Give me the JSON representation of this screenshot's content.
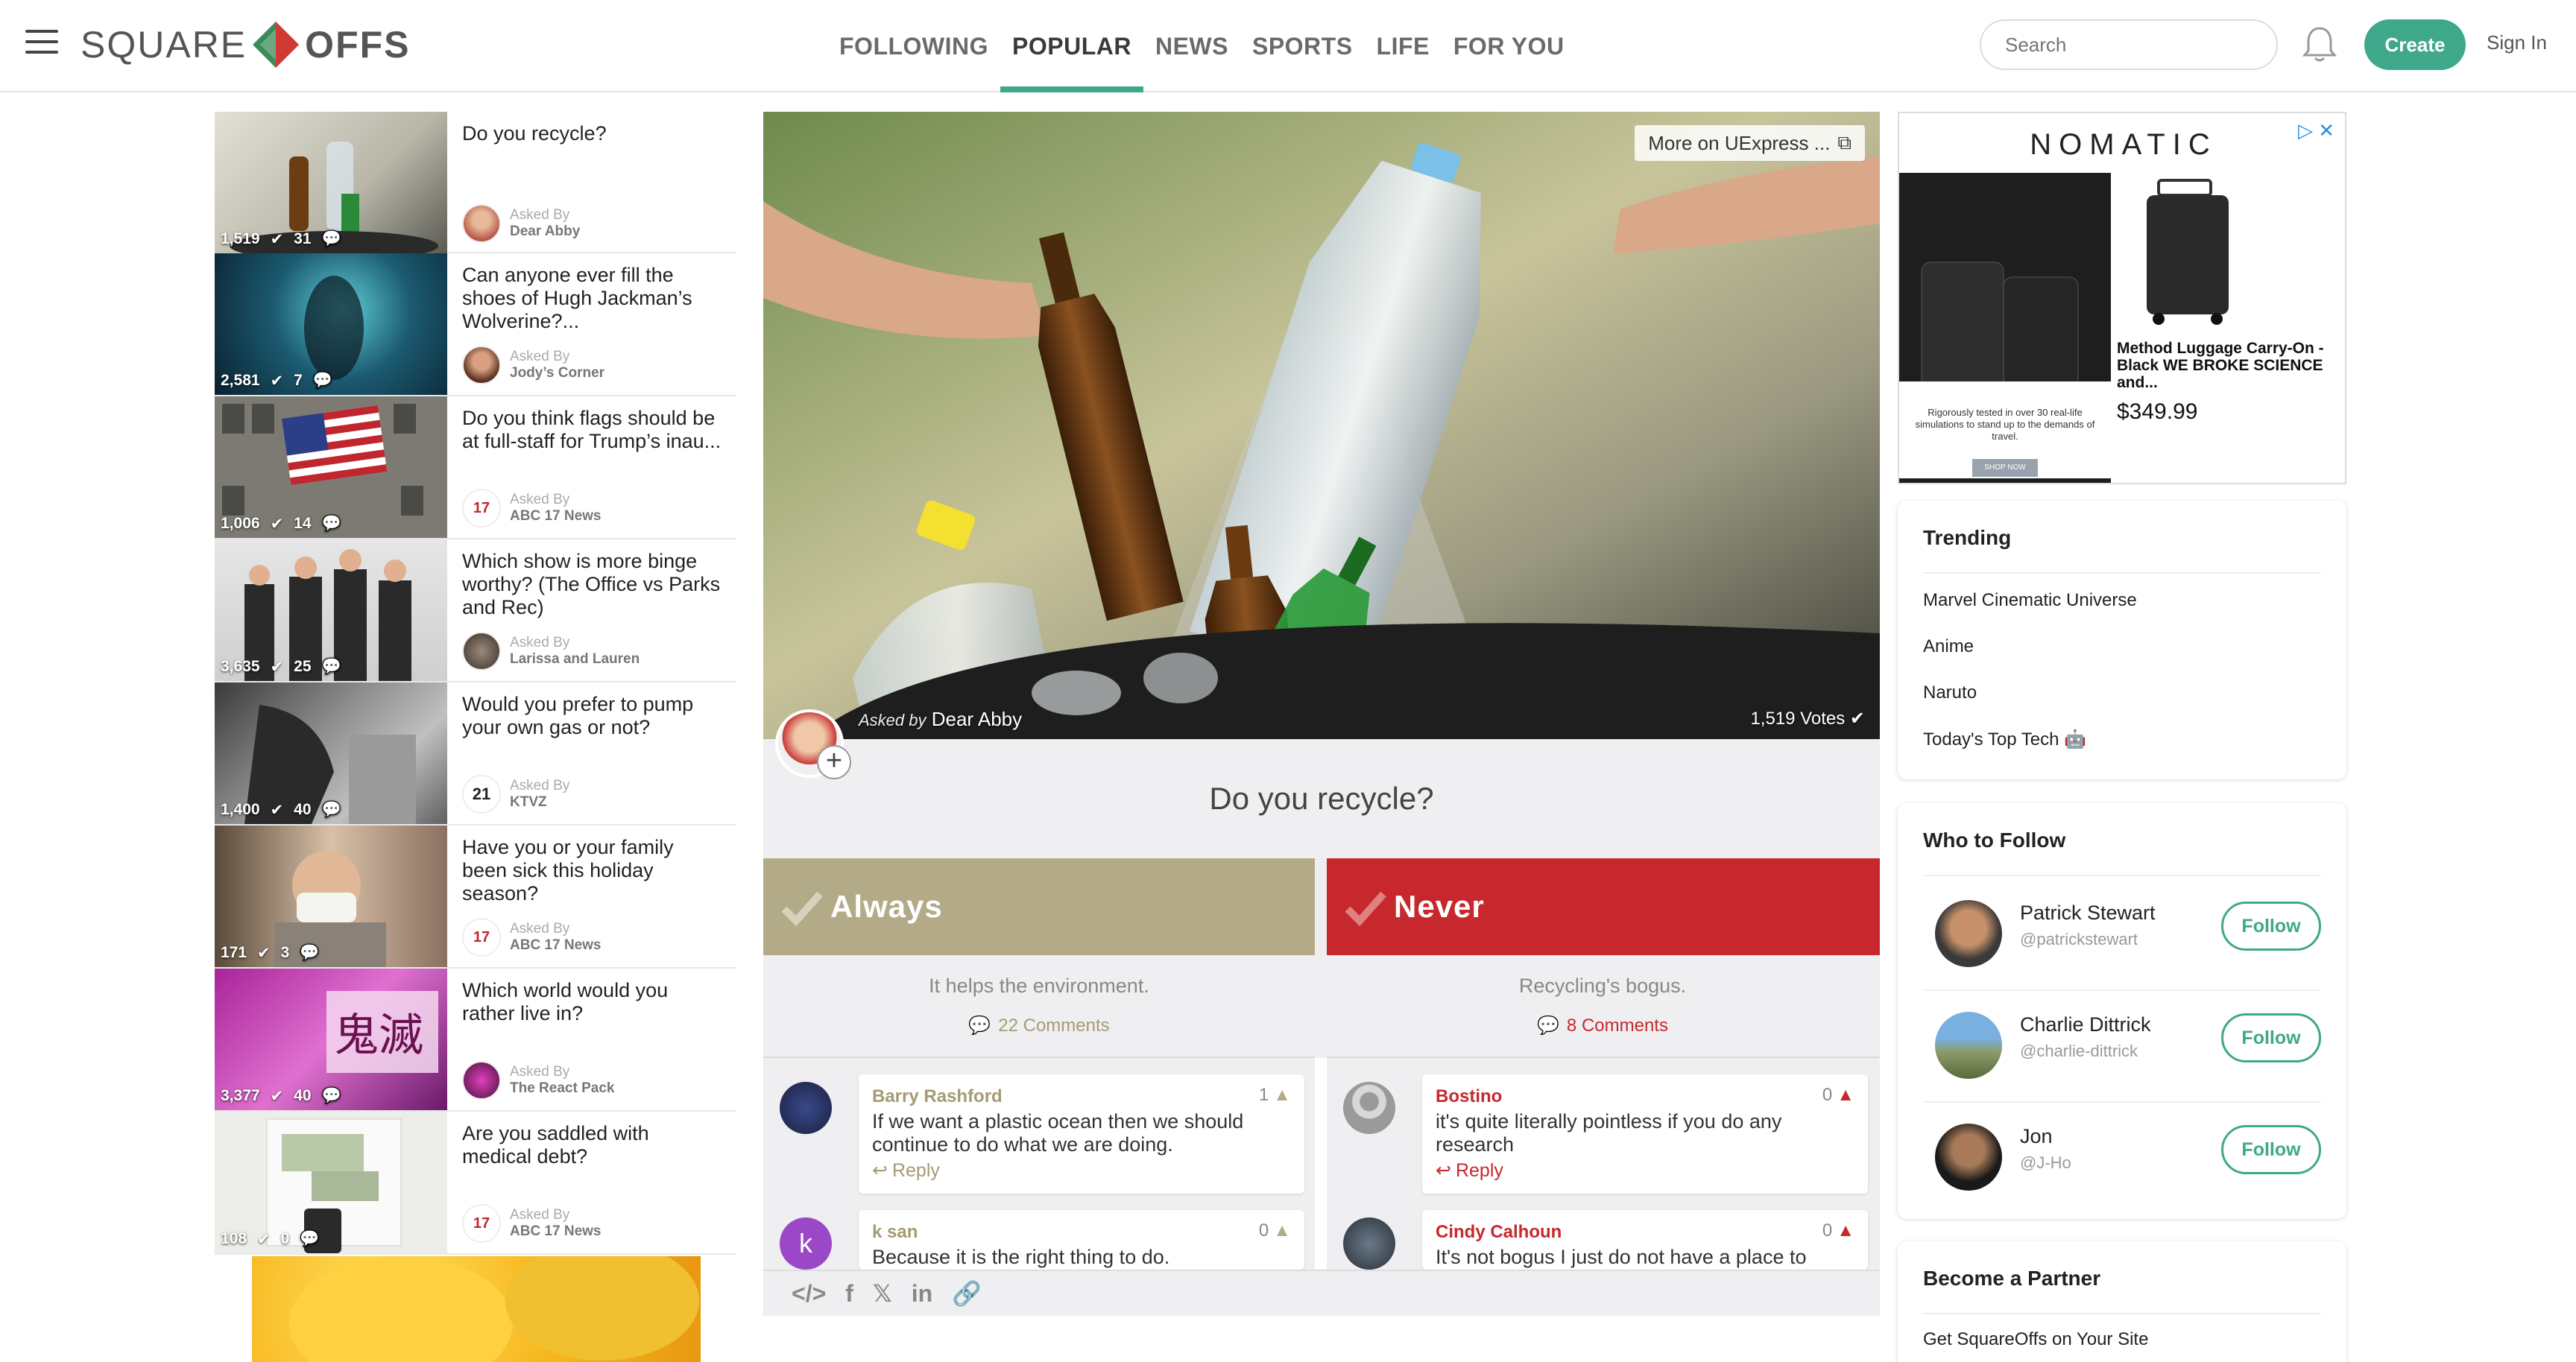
{
  "header": {
    "logo_left": "SQUARE",
    "logo_right": "OFFS",
    "tabs": [
      {
        "label": "FOLLOWING"
      },
      {
        "label": "POPULAR"
      },
      {
        "label": "NEWS"
      },
      {
        "label": "SPORTS"
      },
      {
        "label": "LIFE"
      },
      {
        "label": "FOR YOU"
      }
    ],
    "active_tab": "POPULAR",
    "search_placeholder": "Search",
    "create_label": "Create",
    "signin_label": "Sign In"
  },
  "colors": {
    "accent": "#3fa88a",
    "always": "#b3aa88",
    "never": "#c6282d"
  },
  "feed": [
    {
      "title": "Do you recycle?",
      "votes": "1,519",
      "comments": "31",
      "asked_label": "Asked By",
      "asker": "Dear Abby"
    },
    {
      "title": "Can anyone ever fill the shoes of Hugh Jackman’s Wolverine?...",
      "votes": "2,581",
      "comments": "7",
      "asked_label": "Asked By",
      "asker": "Jody’s Corner"
    },
    {
      "title": "Do you think flags should be at full-staff for Trump’s inau...",
      "votes": "1,006",
      "comments": "14",
      "asked_label": "Asked By",
      "asker": "ABC 17 News"
    },
    {
      "title": "Which show is more binge worthy? (The Office vs Parks and Rec)",
      "votes": "3,635",
      "comments": "25",
      "asked_label": "Asked By",
      "asker": "Larissa and Lauren"
    },
    {
      "title": "Would you prefer to pump your own gas or not?",
      "votes": "1,400",
      "comments": "40",
      "asked_label": "Asked By",
      "asker": "KTVZ"
    },
    {
      "title": "Have you or your family been sick this holiday season?",
      "votes": "171",
      "comments": "3",
      "asked_label": "Asked By",
      "asker": "ABC 17 News"
    },
    {
      "title": "Which world would you rather live in?",
      "votes": "3,377",
      "comments": "40",
      "asked_label": "Asked By",
      "asker": "The React Pack"
    },
    {
      "title": "Are you saddled with medical debt?",
      "votes": "108",
      "comments": "0",
      "asked_label": "Asked By",
      "asker": "ABC 17 News"
    }
  ],
  "main": {
    "more_on": "More on UExpress ...",
    "asked_by_label": "Asked by",
    "asker": "Dear Abby",
    "votes": "1,519 Votes",
    "question": "Do you recycle?",
    "always": {
      "label": "Always",
      "reason": "It helps the environment.",
      "comments": "22 Comments"
    },
    "never": {
      "label": "Never",
      "reason": "Recycling's bogus.",
      "comments": "8 Comments"
    },
    "comments_left": [
      {
        "name": "Barry Rashford",
        "text": "If we want a plastic ocean then we should continue to do what we are doing.",
        "score": "1",
        "reply": "Reply"
      },
      {
        "name": "k san",
        "text": "Because it is the right thing to do.",
        "score": "0",
        "avatar_letter": "k"
      }
    ],
    "comments_right": [
      {
        "name": "Bostino",
        "text": "it's quite literally pointless if you do any research",
        "score": "0",
        "reply": "Reply"
      },
      {
        "name": "Cindy Calhoun",
        "text": "It's not bogus I just do not have a place to",
        "score": "0"
      }
    ]
  },
  "ad": {
    "brand": "NOMATIC",
    "caption": "Rigorously tested in over 30 real-life simulations to stand up to the demands of travel.",
    "shop": "SHOP NOW",
    "product_title": "Method Luggage Carry-On - Black WE BROKE SCIENCE and...",
    "price": "$349.99",
    "close_icon": "close-icon"
  },
  "trending": {
    "title": "Trending",
    "items": [
      "Marvel Cinematic Universe",
      "Anime",
      "Naruto",
      "Today's Top Tech 🤖"
    ]
  },
  "who_to_follow": {
    "title": "Who to Follow",
    "follow_label": "Follow",
    "people": [
      {
        "name": "Patrick Stewart",
        "handle": "@patrickstewart"
      },
      {
        "name": "Charlie Dittrick",
        "handle": "@charlie-dittrick"
      },
      {
        "name": "Jon",
        "handle": "@J-Ho"
      }
    ]
  },
  "partner": {
    "title": "Become a Partner",
    "link": "Get SquareOffs on Your Site"
  }
}
